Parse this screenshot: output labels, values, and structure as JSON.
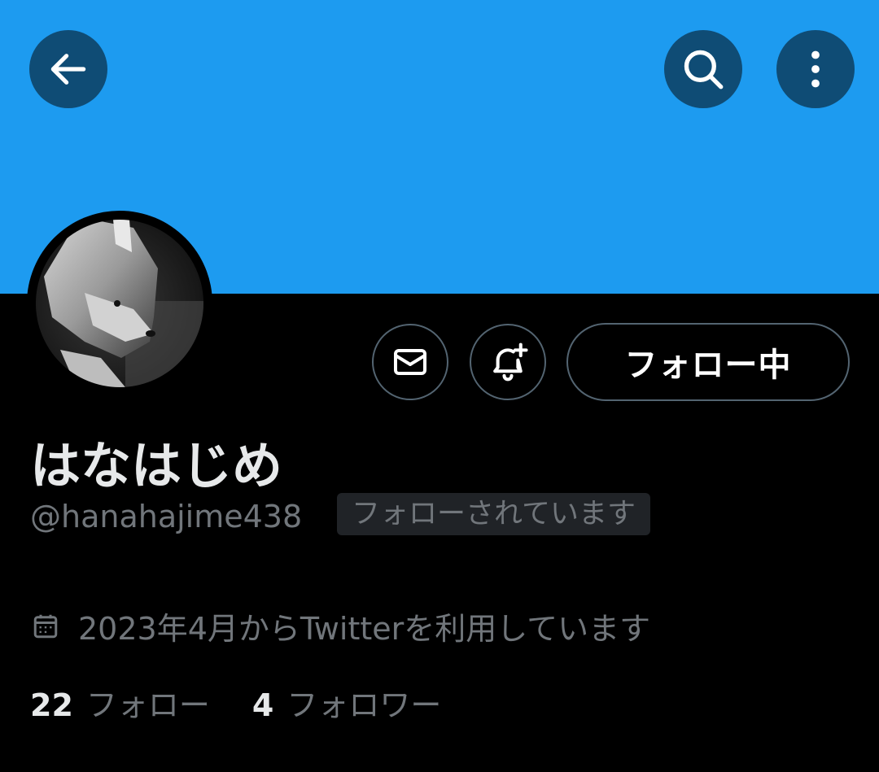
{
  "header": {
    "back_icon": "arrow-left-icon",
    "search_icon": "search-icon",
    "more_icon": "more-vertical-icon",
    "banner_color": "#1d9bf0",
    "button_color": "#0f4c75"
  },
  "profile": {
    "avatar_icon": "avatar",
    "display_name": "はなはじめ",
    "handle": "@hanahajime438",
    "follows_you": "フォローされています",
    "joined": "2023年4月からTwitterを利用しています"
  },
  "actions": {
    "dm_icon": "mail-icon",
    "notify_icon": "bell-plus-icon",
    "follow_label": "フォロー中"
  },
  "stats": {
    "following_count": "22",
    "following_label": "フォロー",
    "followers_count": "4",
    "followers_label": "フォロワー"
  }
}
